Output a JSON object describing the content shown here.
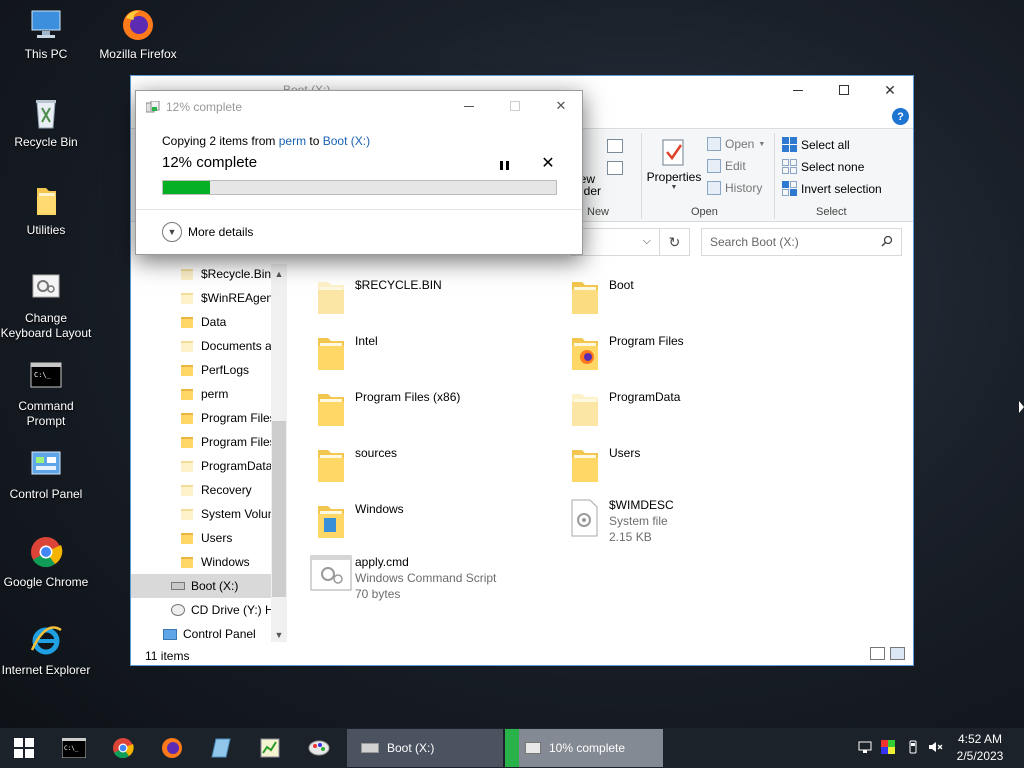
{
  "desktop": {
    "icons": [
      {
        "label": "This PC"
      },
      {
        "label": "Mozilla Firefox"
      },
      {
        "label": "Recycle Bin"
      },
      {
        "label": "Utilities"
      },
      {
        "label": "Change Keyboard Layout"
      },
      {
        "label": "Command Prompt"
      },
      {
        "label": "Control Panel"
      },
      {
        "label": "Google Chrome"
      },
      {
        "label": "Internet Explorer"
      }
    ]
  },
  "explorer": {
    "title": "Boot (X:)",
    "ribbon": {
      "new_group_label": "New",
      "new_folder_label": "New folder",
      "properties_label": "Properties",
      "open_label": "Open",
      "edit_label": "Edit",
      "history_label": "History",
      "open_group_label": "Open",
      "select_all_label": "Select all",
      "select_none_label": "Select none",
      "invert_selection_label": "Invert selection",
      "select_group_label": "Select"
    },
    "search_placeholder": "Search Boot (X:)",
    "nav_items": [
      {
        "label": "$Recycle.Bin"
      },
      {
        "label": "$WinREAgent"
      },
      {
        "label": "Data"
      },
      {
        "label": "Documents a"
      },
      {
        "label": "PerfLogs"
      },
      {
        "label": "perm"
      },
      {
        "label": "Program Files"
      },
      {
        "label": "Program Files"
      },
      {
        "label": "ProgramData"
      },
      {
        "label": "Recovery"
      },
      {
        "label": "System Volun"
      },
      {
        "label": "Users"
      },
      {
        "label": "Windows"
      },
      {
        "label": "Boot (X:)"
      },
      {
        "label": "CD Drive (Y:) H"
      },
      {
        "label": "Control Panel"
      }
    ],
    "files": [
      {
        "name": "$RECYCLE.BIN"
      },
      {
        "name": "Boot"
      },
      {
        "name": "Intel"
      },
      {
        "name": "Program Files"
      },
      {
        "name": "Program Files (x86)"
      },
      {
        "name": "ProgramData"
      },
      {
        "name": "sources"
      },
      {
        "name": "Users"
      },
      {
        "name": "Windows"
      },
      {
        "name": "$WIMDESC",
        "type": "System file",
        "size": "2.15 KB"
      },
      {
        "name": "apply.cmd",
        "type": "Windows Command Script",
        "size": "70 bytes"
      }
    ],
    "status": "11 items"
  },
  "copy_dialog": {
    "title": "12% complete",
    "copying_prefix": "Copying 2 items from ",
    "source": "perm",
    "to_word": " to ",
    "destination": "Boot (X:)",
    "percent_text": "12% complete",
    "progress": 0.12,
    "more_details_label": "More details"
  },
  "taskbar": {
    "task_explorer_label": "Boot (X:)",
    "task_copy_label": "10% complete",
    "time": "4:52 AM",
    "date": "2/5/2023"
  },
  "colors": {
    "accent": "#1e74d1",
    "progress": "#06b025",
    "link": "#1a61b3"
  }
}
